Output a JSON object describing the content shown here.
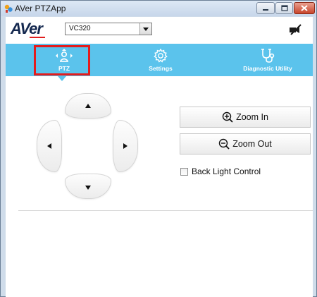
{
  "window": {
    "title": "AVer PTZApp"
  },
  "header": {
    "logo_text": "AVer",
    "camera_select": {
      "selected": "VC320"
    },
    "status_icon": "camera-off-icon"
  },
  "tabs": [
    {
      "label": "PTZ",
      "icon": "ptz-icon",
      "active": true
    },
    {
      "label": "Settings",
      "icon": "gear-icon",
      "active": false
    },
    {
      "label": "Diagnostic Utility",
      "icon": "stethoscope-icon",
      "active": false
    }
  ],
  "ptz": {
    "zoom_in_label": "Zoom In",
    "zoom_out_label": "Zoom Out",
    "backlight_label": "Back Light Control",
    "backlight_checked": false
  },
  "colors": {
    "tab_bar": "#5bc3ec",
    "highlight": "#e41c1c",
    "logo": "#14284f"
  }
}
